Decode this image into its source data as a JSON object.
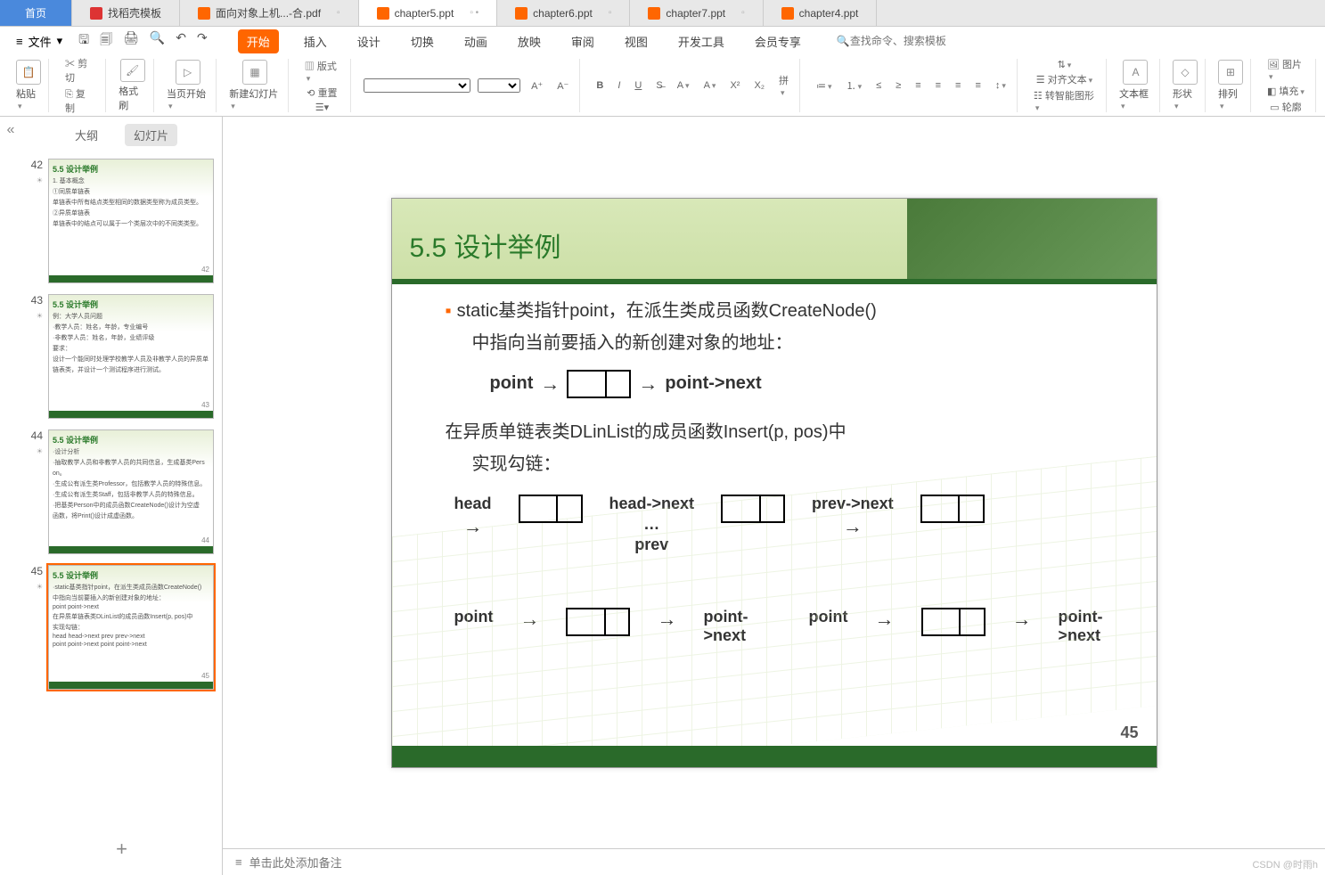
{
  "tabs": {
    "home": "首页",
    "items": [
      {
        "label": "找稻壳模板",
        "icon": "red"
      },
      {
        "label": "面向对象上机...-合.pdf",
        "icon": "orange"
      },
      {
        "label": "chapter5.ppt",
        "icon": "orange",
        "active": true
      },
      {
        "label": "chapter6.ppt",
        "icon": "orange"
      },
      {
        "label": "chapter7.ppt",
        "icon": "orange"
      },
      {
        "label": "chapter4.ppt",
        "icon": "orange"
      }
    ]
  },
  "ribbon": {
    "file": "文件",
    "tabs": [
      "开始",
      "插入",
      "设计",
      "切换",
      "动画",
      "放映",
      "审阅",
      "视图",
      "开发工具",
      "会员专享"
    ],
    "active_tab": "开始",
    "search_placeholder": "查找命令、搜索模板",
    "groups": {
      "paste": "粘贴",
      "cut": "剪切",
      "copy": "复制",
      "format_painter": "格式刷",
      "from_current": "当页开始",
      "new_slide": "新建幻灯片",
      "layout": "版式",
      "reset": "重置",
      "align_text": "对齐文本",
      "smart_graphic": "转智能图形",
      "text_box": "文本框",
      "shapes": "形状",
      "arrange": "排列",
      "picture": "图片",
      "fill": "填充",
      "outline": "轮廓"
    }
  },
  "sidebar": {
    "tab_outline": "大纲",
    "tab_slides": "幻灯片",
    "thumbs": [
      {
        "num": "42",
        "title": "5.5 设计举例",
        "lines": [
          "1. 基本概念",
          "①同质单链表",
          "   单链表中所有结点类型相同的数据类型称为成员类型。",
          "②异质单链表",
          "   单链表中的结点可以属于一个类层次中的不同类类型。"
        ],
        "pg": "42"
      },
      {
        "num": "43",
        "title": "5.5 设计举例",
        "lines": [
          "例：大学人员问题",
          "·教学人员：姓名，年龄，专业编号",
          "·非教学人员：姓名，年龄，业绩评级",
          "要求：",
          "设计一个能同时处理学校教学人员及非教学人员的异质单",
          "链表类，并设计一个测试程序进行测试。"
        ],
        "pg": "43"
      },
      {
        "num": "44",
        "title": "5.5 设计举例",
        "lines": [
          "·设计分析",
          "·抽取教学人员和非教学人员的共同信息，生成基类Pers",
          "on。",
          "·生成公有派生类Professor，包括教学人员的特殊信息。",
          "·生成公有派生类Staff，包括非教学人员的特殊信息。",
          "·把基类Person中的成员函数CreateNode()设计为空虚",
          "函数，将Print()设计成虚函数。"
        ],
        "pg": "44"
      },
      {
        "num": "45",
        "title": "5.5 设计举例",
        "lines": [
          "·static基类指针point，在派生类成员函数CreateNode()",
          "中指向当前要插入的新创建对象的地址：",
          "point     point->next",
          "在异质单链表类DLinList的成员函数Insert(p, pos)中",
          "实现勾链：",
          "head  head->next  prev  prev->next",
          "point point->next  point point->next"
        ],
        "pg": "45",
        "selected": true
      }
    ],
    "add": "+"
  },
  "slide": {
    "title": "5.5 设计举例",
    "bullet1a": "static基类指针point，在派生类成员函数CreateNode()",
    "bullet1b": "中指向当前要插入的新创建对象的地址：",
    "diag1_point": "point",
    "diag1_next": "point->next",
    "bullet2a": "在异质单链表类DLinList的成员函数Insert(p, pos)中",
    "bullet2b": "实现勾链：",
    "row_labels": {
      "head": "head",
      "head_next": "head->next",
      "dots": "…",
      "prev": "prev",
      "prev_next": "prev->next"
    },
    "bottom": {
      "point": "point",
      "point_next": "point->next"
    },
    "page": "45"
  },
  "notes": {
    "placeholder": "单击此处添加备注"
  },
  "watermark": "CSDN @时雨h"
}
